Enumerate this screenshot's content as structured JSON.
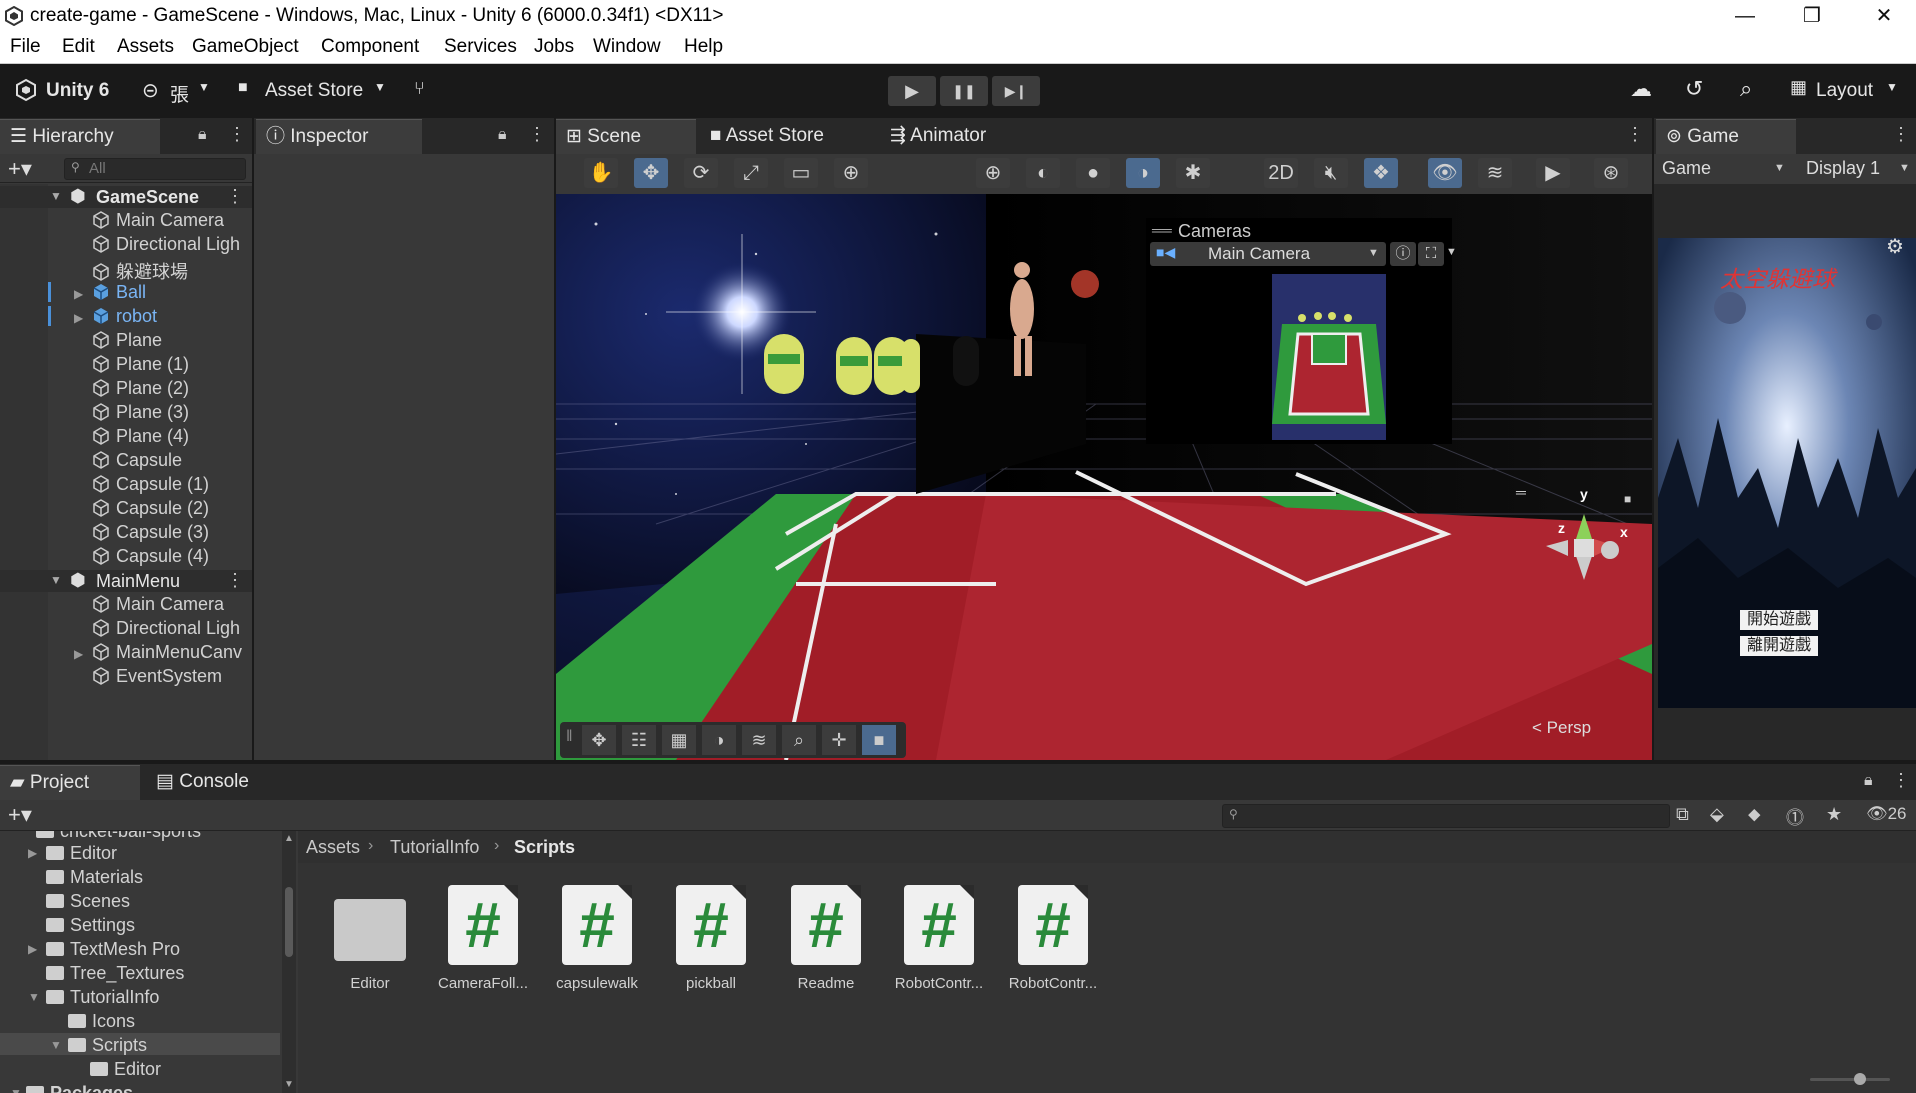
{
  "window": {
    "title": "create-game - GameScene - Windows, Mac, Linux - Unity 6 (6000.0.34f1) <DX11>",
    "minimize": "—",
    "maximize": "❐",
    "close": "✕"
  },
  "menu": [
    "File",
    "Edit",
    "Assets",
    "GameObject",
    "Component",
    "Services",
    "Jobs",
    "Window",
    "Help"
  ],
  "toolbar": {
    "product": "Unity 6",
    "account": "張",
    "asset_store": "Asset Store",
    "layout": "Layout",
    "play": "▶",
    "pause": "❚❚",
    "step": "▶❙"
  },
  "hierarchy": {
    "tab": "Hierarchy",
    "search_placeholder": "All",
    "scenes": [
      {
        "name": "GameScene",
        "items": [
          "Main Camera",
          "Directional Ligh",
          "躲避球場",
          "Ball",
          "robot",
          "Plane",
          "Plane (1)",
          "Plane (2)",
          "Plane (3)",
          "Plane (4)",
          "Capsule",
          "Capsule (1)",
          "Capsule (2)",
          "Capsule (3)",
          "Capsule (4)"
        ]
      },
      {
        "name": "MainMenu",
        "items": [
          "Main Camera",
          "Directional Ligh",
          "MainMenuCanv",
          "EventSystem"
        ]
      }
    ]
  },
  "inspector": {
    "tab": "Inspector"
  },
  "scene": {
    "tabs": [
      "Scene",
      "Asset Store",
      "Animator"
    ],
    "cameras_label": "Cameras",
    "camera_select": "Main Camera",
    "persp": "< Persp",
    "gizmo": {
      "x": "x",
      "y": "y",
      "z": "z"
    }
  },
  "game": {
    "tab": "Game",
    "mode": "Game",
    "display": "Display 1",
    "title_text": "太空躲避球",
    "start_button": "開始遊戲",
    "exit_button": "離開遊戲"
  },
  "project": {
    "tabs": [
      "Project",
      "Console"
    ],
    "breadcrumb": [
      "Assets",
      "TutorialInfo",
      "Scripts"
    ],
    "count": "26",
    "tree": [
      "cricket-ball-sports",
      "Editor",
      "Materials",
      "Scenes",
      "Settings",
      "TextMesh Pro",
      "Tree_Textures",
      "TutorialInfo",
      "Icons",
      "Scripts",
      "Editor",
      "Packages"
    ],
    "assets": [
      "Editor",
      "CameraFoll...",
      "capsulewalk",
      "pickball",
      "Readme",
      "RobotContr...",
      "RobotContr..."
    ]
  }
}
